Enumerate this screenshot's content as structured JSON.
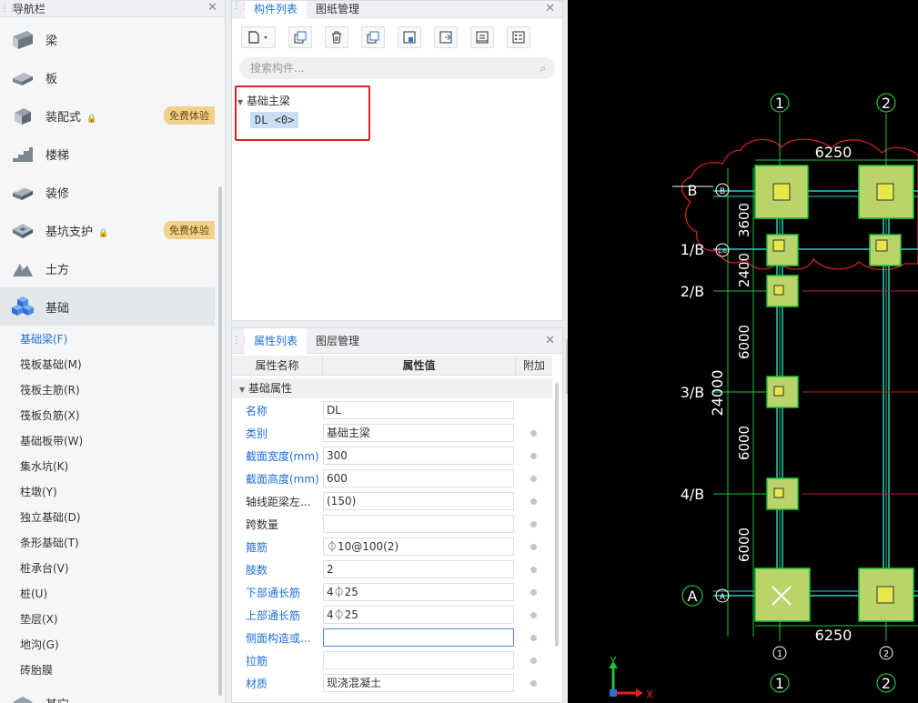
{
  "nav": {
    "title": "导航栏",
    "items": [
      {
        "label": "梁",
        "icon": "beam-icon"
      },
      {
        "label": "板",
        "icon": "slab-icon"
      },
      {
        "label": "装配式",
        "icon": "prefab-icon",
        "badge": "免费体验"
      },
      {
        "label": "楼梯",
        "icon": "stairs-icon"
      },
      {
        "label": "装修",
        "icon": "decoration-icon"
      },
      {
        "label": "基坑支护",
        "icon": "pit-support-icon",
        "badge": "免费体验"
      },
      {
        "label": "土方",
        "icon": "earthwork-icon"
      },
      {
        "label": "基础",
        "icon": "foundation-icon"
      }
    ],
    "subitems": [
      "基础梁(F)",
      "筏板基础(M)",
      "筏板主筋(R)",
      "筏板负筋(X)",
      "基础板带(W)",
      "集水坑(K)",
      "柱墩(Y)",
      "独立基础(D)",
      "条形基础(T)",
      "桩承台(V)",
      "桩(U)",
      "垫层(X)",
      "地沟(G)",
      "砖胎膜"
    ],
    "next_label": "其它"
  },
  "comp": {
    "tabs": [
      "构件列表",
      "图纸管理"
    ],
    "toolbar": [
      "new-icon",
      "copy-icon",
      "delete-icon",
      "copy-to-floor-icon",
      "import-icon",
      "export-icon",
      "layer-icon",
      "list-icon"
    ],
    "search_placeholder": "搜索构件...",
    "tree_group": "基础主梁",
    "tree_item": "DL <0>"
  },
  "prop": {
    "tabs": [
      "属性列表",
      "图层管理"
    ],
    "col_name": "属性名称",
    "col_value": "属性值",
    "col_extra": "附加",
    "group": "基础属性",
    "rows": [
      {
        "name": "名称",
        "value": "DL",
        "blue": true,
        "dot": false
      },
      {
        "name": "类别",
        "value": "基础主梁",
        "blue": true,
        "dot": true
      },
      {
        "name": "截面宽度(mm)",
        "value": "300",
        "blue": true,
        "dot": true
      },
      {
        "name": "截面高度(mm)",
        "value": "600",
        "blue": true,
        "dot": true
      },
      {
        "name": "轴线距梁左...",
        "value": "(150)",
        "blue": false,
        "dot": true
      },
      {
        "name": "跨数量",
        "value": "",
        "blue": false,
        "dot": true
      },
      {
        "name": "箍筋",
        "value": "⏀10@100(2)",
        "blue": true,
        "dot": true
      },
      {
        "name": "肢数",
        "value": "2",
        "blue": true,
        "dot": true
      },
      {
        "name": "下部通长筋",
        "value": "4⏀25",
        "blue": true,
        "dot": true
      },
      {
        "name": "上部通长筋",
        "value": "4⏀25",
        "blue": true,
        "dot": true
      },
      {
        "name": "侧面构造或...",
        "value": "",
        "blue": true,
        "dot": true
      },
      {
        "name": "拉筋",
        "value": "",
        "blue": true,
        "dot": true
      },
      {
        "name": "材质",
        "value": "现浇混凝土",
        "blue": true,
        "dot": true
      }
    ]
  },
  "cad": {
    "axis_top": [
      "1",
      "2"
    ],
    "axis_bottom": [
      "1",
      "2"
    ],
    "axis_bottom_small": [
      "1",
      "2"
    ],
    "dim_top": "6250",
    "dim_bottom": "6250",
    "dim_total": "24000",
    "dims_vert": [
      "3600",
      "2400",
      "6000",
      "6000",
      "6000"
    ],
    "rows": [
      "B",
      "1/B",
      "2/B",
      "3/B",
      "4/B",
      "A"
    ],
    "row_bubbles": [
      "B",
      "1/B",
      "A"
    ],
    "ucs_y": "Y",
    "ucs_x": "X"
  }
}
